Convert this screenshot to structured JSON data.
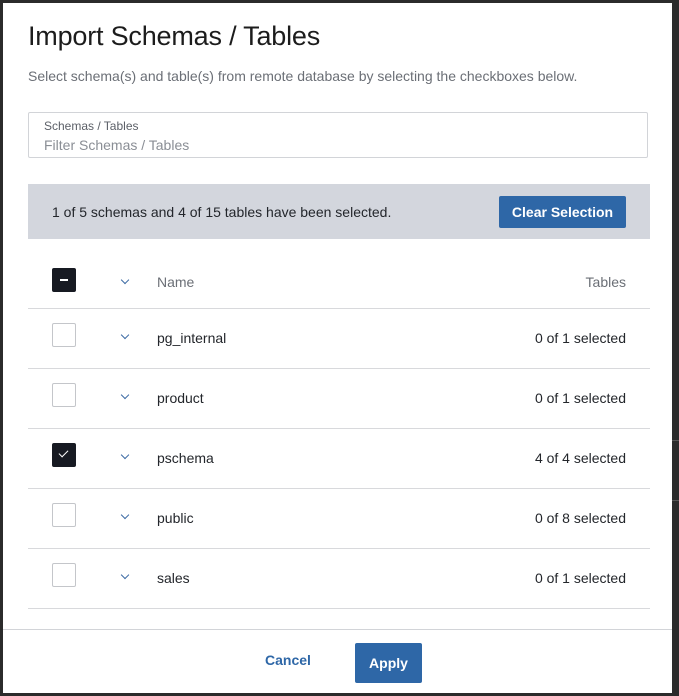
{
  "dialog": {
    "title": "Import Schemas / Tables",
    "subtitle": "Select schema(s) and table(s) from remote database by selecting the checkboxes below."
  },
  "filter": {
    "label": "Schemas / Tables",
    "placeholder": "Filter Schemas / Tables",
    "value": ""
  },
  "selection_bar": {
    "text": "1 of 5 schemas and 4 of 15 tables have been selected.",
    "clear_label": "Clear Selection"
  },
  "table": {
    "header": {
      "select_all_state": "indeterminate",
      "name_label": "Name",
      "tables_label": "Tables"
    },
    "rows": [
      {
        "name": "pg_internal",
        "checked": false,
        "tables": "0 of 1 selected"
      },
      {
        "name": "product",
        "checked": false,
        "tables": "0 of 1 selected"
      },
      {
        "name": "pschema",
        "checked": true,
        "tables": "4 of 4 selected"
      },
      {
        "name": "public",
        "checked": false,
        "tables": "0 of 8 selected"
      },
      {
        "name": "sales",
        "checked": false,
        "tables": "0 of 1 selected"
      }
    ]
  },
  "footer": {
    "cancel_label": "Cancel",
    "apply_label": "Apply"
  },
  "colors": {
    "primary": "#2e67a7",
    "selection_bar_bg": "#d3d6dd",
    "checkbox_checked": "#171a22"
  }
}
